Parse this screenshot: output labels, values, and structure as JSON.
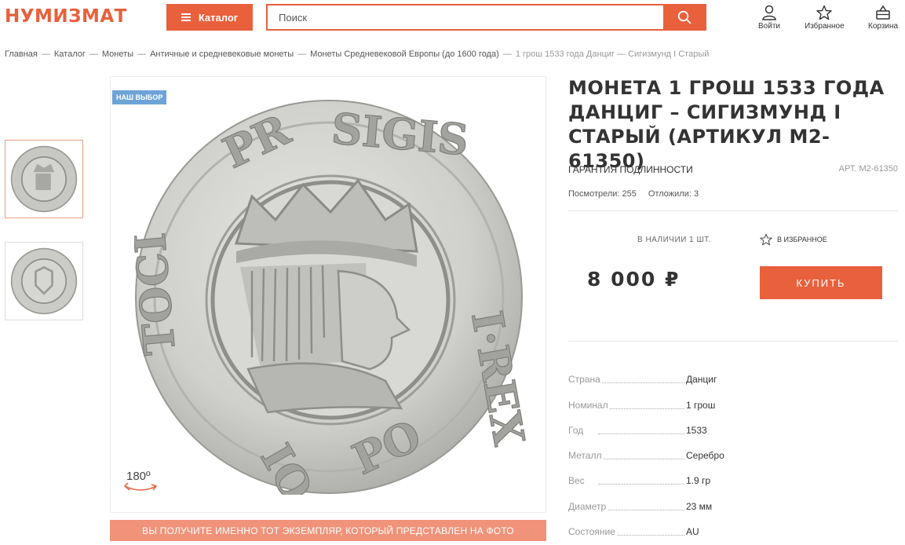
{
  "header": {
    "logo": "НУМИЗМАТ",
    "catalog_label": "Каталог",
    "search_placeholder": "Поиск",
    "login_label": "Войти",
    "favorites_label": "Избранное",
    "cart_label": "Корзина"
  },
  "breadcrumbs": [
    "Главная",
    "Каталог",
    "Монеты",
    "Античные и средневековые монеты",
    "Монеты Средневековой Европы (до 1600 года)",
    "1 грош 1533 года Данциг — Сигизмунд I Старый"
  ],
  "product": {
    "badge": "НАШ ВЫБОР",
    "rotate_label": "180º",
    "photo_notice": "ВЫ ПОЛУЧИТЕ ИМЕННО ТОТ ЭКЗЕМПЛЯР, КОТОРЫЙ ПРЕДСТАВЛЕН НА ФОТО",
    "title": "МОНЕТА 1 ГРОШ 1533 ГОДА ДАНЦИГ – СИГИЗМУНД I СТАРЫЙ (АРТИКУЛ М2-61350)",
    "guarantee": "ГАРАНТИЯ ПОДЛИННОСТИ",
    "article": "АРТ. М2-61350",
    "views": "Посмотрели: 255",
    "saved": "Отложили: 3",
    "stock": "В НАЛИЧИИ 1 ШТ.",
    "fav_label": "В ИЗБРАННОЕ",
    "price": "8 000 ₽",
    "buy_label": "КУПИТЬ"
  },
  "specs": [
    {
      "key": "Страна",
      "value": "Данциг"
    },
    {
      "key": "Номинал",
      "value": "1 грош"
    },
    {
      "key": "Год",
      "value": "1533"
    },
    {
      "key": "Металл",
      "value": "Серебро"
    },
    {
      "key": "Вес",
      "value": "1.9 гр"
    },
    {
      "key": "Диаметр",
      "value": "23 мм"
    },
    {
      "key": "Состояние",
      "value": "AU"
    }
  ],
  "colors": {
    "accent": "#e8603c",
    "badge": "#6ea3d8",
    "notice": "#f0937a"
  }
}
